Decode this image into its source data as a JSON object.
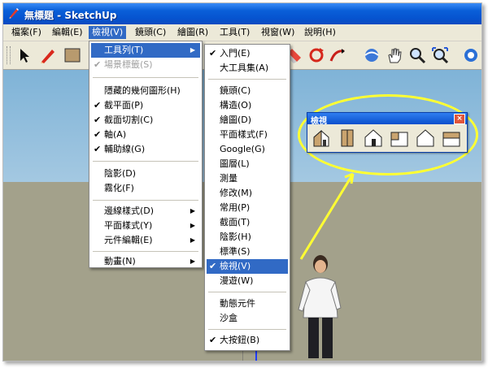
{
  "window": {
    "title": "無標題 - SketchUp"
  },
  "menubar": {
    "items": [
      {
        "label": "檔案(F)"
      },
      {
        "label": "編輯(E)"
      },
      {
        "label": "檢視(V)"
      },
      {
        "label": "鏡頭(C)"
      },
      {
        "label": "繪圖(R)"
      },
      {
        "label": "工具(T)"
      },
      {
        "label": "視窗(W)"
      },
      {
        "label": "說明(H)"
      }
    ]
  },
  "toolbar": {
    "tools": [
      "select-arrow-icon",
      "pencil-icon",
      "rectangle-icon",
      "eraser-icon",
      "orbit-icon",
      "pan-hand-icon",
      "zoom-icon",
      "zoom-extents-icon",
      "globe-icon"
    ]
  },
  "view_menu": {
    "items": [
      {
        "label": "工具列(T)",
        "submenu": true,
        "highlight": true
      },
      {
        "label": "場景標籤(S)",
        "checked": true,
        "disabled": true
      },
      {
        "label": "隱藏的幾何圖形(H)"
      },
      {
        "label": "截平面(P)",
        "checked": true
      },
      {
        "label": "截面切割(C)",
        "checked": true
      },
      {
        "label": "軸(A)",
        "checked": true
      },
      {
        "label": "輔助線(G)",
        "checked": true
      },
      {
        "label": "陰影(D)"
      },
      {
        "label": "霧化(F)"
      },
      {
        "label": "邊線樣式(D)",
        "submenu": true
      },
      {
        "label": "平面樣式(Y)",
        "submenu": true
      },
      {
        "label": "元件編輯(E)",
        "submenu": true
      },
      {
        "label": "動畫(N)",
        "submenu": true
      }
    ]
  },
  "toolbar_submenu": {
    "items": [
      {
        "label": "入門(E)",
        "checked": true
      },
      {
        "label": "大工具集(A)"
      },
      {
        "label": "鏡頭(C)"
      },
      {
        "label": "構造(O)"
      },
      {
        "label": "繪圖(D)"
      },
      {
        "label": "平面樣式(F)"
      },
      {
        "label": "Google(G)"
      },
      {
        "label": "圖層(L)"
      },
      {
        "label": "測量"
      },
      {
        "label": "修改(M)"
      },
      {
        "label": "常用(P)"
      },
      {
        "label": "截面(T)"
      },
      {
        "label": "陰影(H)"
      },
      {
        "label": "標準(S)"
      },
      {
        "label": "檢視(V)",
        "checked": true,
        "highlight": true
      },
      {
        "label": "漫遊(W)"
      },
      {
        "label": "動態元件"
      },
      {
        "label": "沙盒"
      },
      {
        "label": "大按鈕(B)",
        "checked": true
      }
    ]
  },
  "views_toolbar": {
    "title": "檢視",
    "close_label": "×",
    "buttons": [
      "iso-view-icon",
      "top-view-icon",
      "front-view-icon",
      "right-view-icon",
      "back-view-icon",
      "left-view-icon"
    ]
  },
  "colors": {
    "highlight": "#316ac5",
    "annotation": "#ffff33",
    "titlebar": "#0a5fd8"
  }
}
